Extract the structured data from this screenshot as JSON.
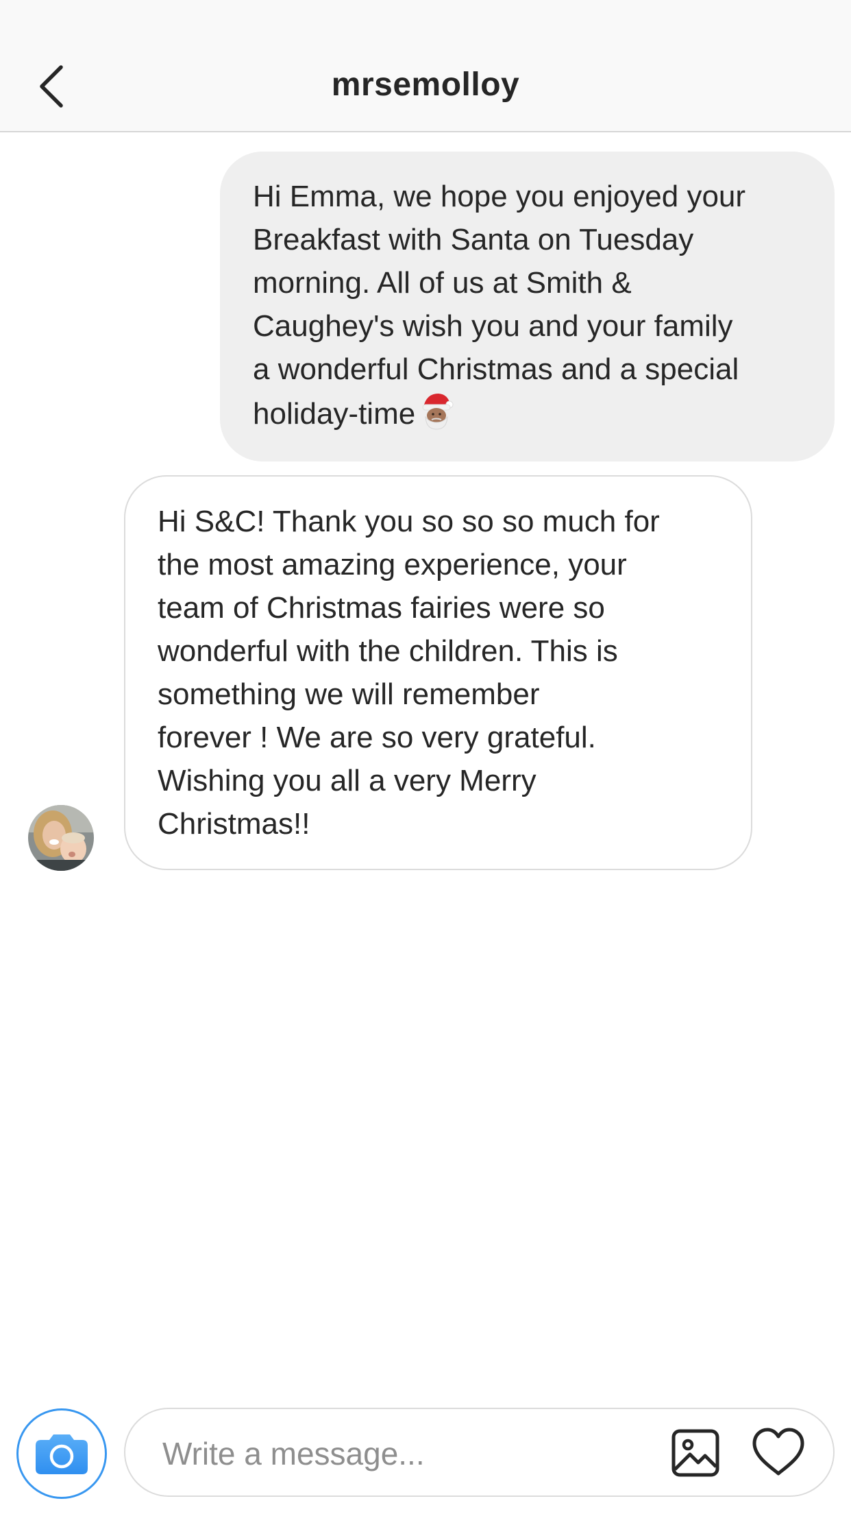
{
  "header": {
    "title": "mrsemolloy",
    "back_icon": "chevron-left-icon"
  },
  "messages": [
    {
      "direction": "outgoing",
      "text": "Hi Emma, we hope you enjoyed your\nBreakfast with Santa on Tuesday\nmorning. All of us at Smith &\nCaughey's wish you and your family\na wonderful Christmas and a special\nholiday-time",
      "emoji": "santa-emoji-icon"
    },
    {
      "direction": "incoming",
      "text": "Hi S&C! Thank you so so so much for\nthe most amazing experience, your\nteam of Christmas fairies were so\nwonderful with the children. This is\nsomething we will remember\nforever ! We are so very grateful.\nWishing you all a very Merry\nChristmas!!"
    }
  ],
  "composer": {
    "placeholder": "Write a message...",
    "camera_icon": "camera-icon",
    "gallery_icon": "image-gallery-icon",
    "like_icon": "heart-icon"
  },
  "colors": {
    "accent": "#3897f0",
    "outgoing_bubble": "#efefef",
    "text": "#262626",
    "placeholder": "#8e8e8e"
  }
}
